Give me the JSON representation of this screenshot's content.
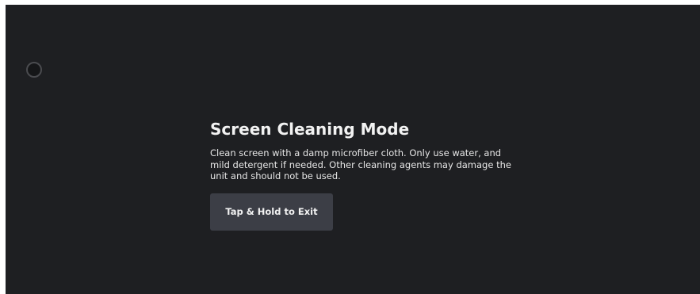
{
  "cleaning_mode": {
    "title": "Screen Cleaning Mode",
    "description": "Clean screen with a damp microfiber cloth. Only use water, and mild detergent if needed. Other cleaning agents may damage the unit and should not be used.",
    "exit_button_label": "Tap & Hold to Exit"
  },
  "colors": {
    "background": "#1e1f22",
    "button": "#3c3e46",
    "text": "#f2f2f2"
  }
}
